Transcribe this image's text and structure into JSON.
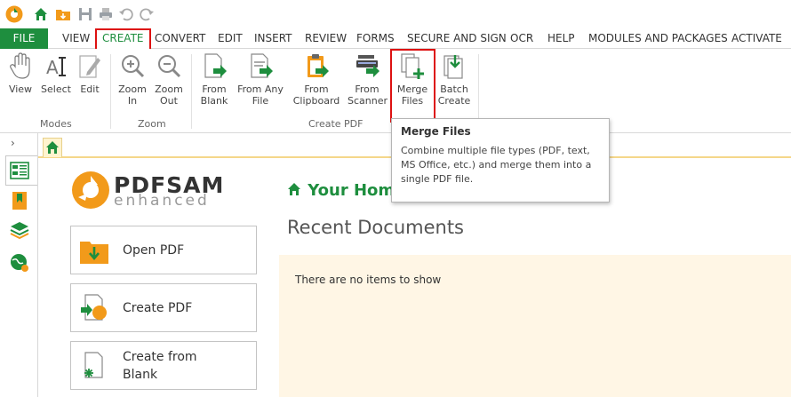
{
  "menu": {
    "file": "FILE",
    "tabs": [
      "VIEW",
      "CREATE",
      "CONVERT",
      "EDIT",
      "INSERT",
      "REVIEW",
      "FORMS",
      "SECURE AND SIGN",
      "OCR",
      "HELP",
      "MODULES AND PACKAGES",
      "ACTIVATE"
    ],
    "active_tab": "CREATE"
  },
  "ribbon": {
    "groups": {
      "modes": "Modes",
      "zoom": "Zoom",
      "create_pdf": "Create PDF"
    },
    "buttons": {
      "view": "View",
      "select": "Select",
      "edit": "Edit",
      "zoom_in_1": "Zoom",
      "zoom_in_2": "In",
      "zoom_out_1": "Zoom",
      "zoom_out_2": "Out",
      "from_blank_1": "From",
      "from_blank_2": "Blank",
      "from_any_file_1": "From Any",
      "from_any_file_2": "File",
      "from_clipboard_1": "From",
      "from_clipboard_2": "Clipboard",
      "from_scanner_1": "From",
      "from_scanner_2": "Scanner",
      "merge_files_1": "Merge",
      "merge_files_2": "Files",
      "batch_create_1": "Batch",
      "batch_create_2": "Create"
    }
  },
  "tooltip": {
    "title": "Merge Files",
    "body": "Combine multiple file types (PDF, text, MS Office, etc.) and merge them into a single PDF file."
  },
  "brand": {
    "name": "PDFSAM",
    "sub": "enhanced"
  },
  "actions": {
    "open_pdf": "Open PDF",
    "create_pdf": "Create PDF",
    "create_from_blank_1": "Create from",
    "create_from_blank_2": "Blank"
  },
  "home": {
    "title": "Your Hom",
    "recent_title": "Recent Documents",
    "empty": "There are no items to show"
  },
  "colors": {
    "accent_green": "#1e8e3e",
    "highlight_red": "#dd1111",
    "recent_bg": "#fff6e5",
    "brand_orange": "#f29a1a"
  }
}
